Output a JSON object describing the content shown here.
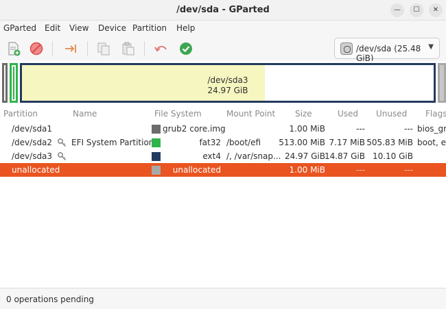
{
  "window": {
    "title": "/dev/sda - GParted"
  },
  "menu": {
    "items": [
      "GParted",
      "Edit",
      "View",
      "Device",
      "Partition",
      "Help"
    ]
  },
  "device_selector": {
    "label": "/dev/sda (25.48 GiB)"
  },
  "partition_map": {
    "sda3_name": "/dev/sda3",
    "sda3_size": "24.97 GiB",
    "sda3_used_fraction": 0.59
  },
  "table": {
    "headers": [
      "Partition",
      "Name",
      "File System",
      "Mount Point",
      "Size",
      "Used",
      "Unused",
      "Flags"
    ],
    "rows": [
      {
        "partition": "/dev/sda1",
        "name": "",
        "fs_swatch": "#6c6c6c",
        "fs": "grub2 core.img",
        "mount": "",
        "size": "1.00 MiB",
        "used": "---",
        "unused": "---",
        "flags": "bios_gr"
      },
      {
        "partition": "/dev/sda2",
        "name": "EFI System Partition",
        "fs_swatch": "#2fb44a",
        "fs": "fat32",
        "mount": "/boot/efi",
        "size": "513.00 MiB",
        "used": "7.17 MiB",
        "unused": "505.83 MiB",
        "flags": "boot, es"
      },
      {
        "partition": "/dev/sda3",
        "name": "",
        "fs_swatch": "#223a5e",
        "fs": "ext4",
        "mount": "/, /var/snap...",
        "size": "24.97 GiB",
        "used": "14.87 GiB",
        "unused": "10.10 GiB",
        "flags": ""
      },
      {
        "partition": "unallocated",
        "name": "",
        "fs_swatch": "#a8a8a8",
        "fs": "unallocated",
        "mount": "",
        "size": "1.00 MiB",
        "used": "---",
        "unused": "---",
        "flags": ""
      }
    ]
  },
  "status": {
    "text": "0 operations pending"
  },
  "colors": {
    "accent": "#e95420",
    "grub": "#6c6c6c",
    "fat32": "#2fb44a",
    "ext4": "#223a5e",
    "unallocated": "#a8a8a8",
    "used_space": "#f6f6c0"
  }
}
